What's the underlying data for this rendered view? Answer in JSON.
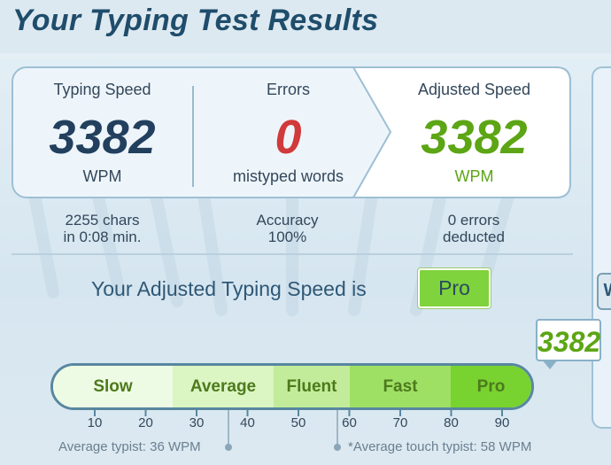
{
  "page": {
    "title": "Your Typing Test Results"
  },
  "results": {
    "typing_speed": {
      "label": "Typing Speed",
      "value": "3382",
      "unit": "WPM"
    },
    "errors": {
      "label": "Errors",
      "value": "0",
      "unit": "mistyped words"
    },
    "adjusted_speed": {
      "label": "Adjusted Speed",
      "value": "3382",
      "unit": "WPM"
    }
  },
  "stats": {
    "chars_line1": "2255 chars",
    "chars_line2": "in 0:08 min.",
    "accuracy_line1": "Accuracy",
    "accuracy_line2": "100%",
    "deducted_line1": "0 errors",
    "deducted_line2": "deducted"
  },
  "adjusted": {
    "text": "Your Adjusted Typing Speed is",
    "level": "Pro"
  },
  "marker": {
    "value": "3382"
  },
  "scale": {
    "segments": [
      {
        "label": "Slow",
        "color": "#eefbe4"
      },
      {
        "label": "Average",
        "color": "#dbf5c3"
      },
      {
        "label": "Fluent",
        "color": "#c2ec9a"
      },
      {
        "label": "Fast",
        "color": "#9ee064"
      },
      {
        "label": "Pro",
        "color": "#78d22f"
      }
    ],
    "ticks": [
      "10",
      "20",
      "30",
      "40",
      "50",
      "60",
      "70",
      "80",
      "90"
    ],
    "average_typist": "Average typist: 36 WPM",
    "touch_typist": "*Average touch typist: 58 WPM"
  },
  "side": {
    "badge": "W"
  },
  "colors": {
    "accent_green": "#5ca514",
    "error_red": "#d13a3a",
    "title_blue": "#1f4d6b"
  }
}
